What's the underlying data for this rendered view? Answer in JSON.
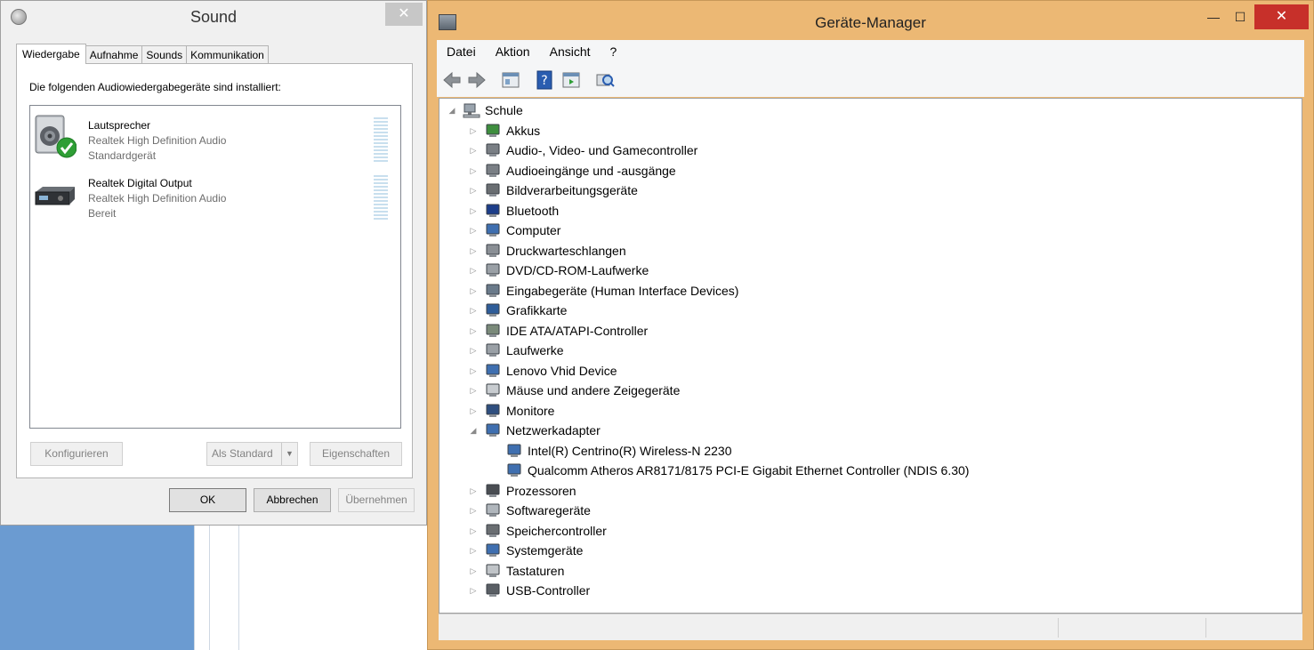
{
  "sound": {
    "title": "Sound",
    "close_glyph": "✕",
    "tabs": [
      "Wiedergabe",
      "Aufnahme",
      "Sounds",
      "Kommunikation"
    ],
    "heading": "Die folgenden Audiowiedergabegeräte sind installiert:",
    "devices": [
      {
        "name": "Lautsprecher",
        "driver": "Realtek High Definition Audio",
        "status": "Standardgerät",
        "icon": "speaker-icon"
      },
      {
        "name": "Realtek Digital Output",
        "driver": "Realtek High Definition Audio",
        "status": "Bereit",
        "icon": "digital-output-icon"
      }
    ],
    "buttons": {
      "configure": "Konfigurieren",
      "set_default": "Als Standard",
      "properties": "Eigenschaften",
      "ok": "OK",
      "cancel": "Abbrechen",
      "apply": "Übernehmen"
    }
  },
  "devmgr": {
    "title": "Geräte-Manager",
    "window_buttons": {
      "minimize": "—",
      "maximize": "☐",
      "close": "✕"
    },
    "menu": [
      "Datei",
      "Aktion",
      "Ansicht",
      "?"
    ],
    "root": "Schule",
    "categories": [
      {
        "label": "Akkus",
        "icon": "battery-icon"
      },
      {
        "label": "Audio-, Video- und Gamecontroller",
        "icon": "audio-icon"
      },
      {
        "label": "Audioeingänge und -ausgänge",
        "icon": "audio-io-icon"
      },
      {
        "label": "Bildverarbeitungsgeräte",
        "icon": "camera-icon"
      },
      {
        "label": "Bluetooth",
        "icon": "bluetooth-icon"
      },
      {
        "label": "Computer",
        "icon": "computer-icon"
      },
      {
        "label": "Druckwarteschlangen",
        "icon": "printer-icon"
      },
      {
        "label": "DVD/CD-ROM-Laufwerke",
        "icon": "dvd-icon"
      },
      {
        "label": "Eingabegeräte (Human Interface Devices)",
        "icon": "hid-icon"
      },
      {
        "label": "Grafikkarte",
        "icon": "display-adapter-icon"
      },
      {
        "label": "IDE ATA/ATAPI-Controller",
        "icon": "ide-icon"
      },
      {
        "label": "Laufwerke",
        "icon": "disk-drive-icon"
      },
      {
        "label": "Lenovo Vhid Device",
        "icon": "network-device-icon"
      },
      {
        "label": "Mäuse und andere Zeigegeräte",
        "icon": "mouse-icon"
      },
      {
        "label": "Monitore",
        "icon": "monitor-icon"
      },
      {
        "label": "Netzwerkadapter",
        "icon": "network-adapter-icon"
      }
    ],
    "network_children": [
      "Intel(R) Centrino(R) Wireless-N 2230",
      "Qualcomm Atheros AR8171/8175 PCI-E Gigabit Ethernet Controller (NDIS 6.30)"
    ],
    "categories_after": [
      {
        "label": "Prozessoren",
        "icon": "processor-icon"
      },
      {
        "label": "Softwaregeräte",
        "icon": "software-device-icon"
      },
      {
        "label": "Speichercontroller",
        "icon": "storage-controller-icon"
      },
      {
        "label": "Systemgeräte",
        "icon": "system-device-icon"
      },
      {
        "label": "Tastaturen",
        "icon": "keyboard-icon"
      },
      {
        "label": "USB-Controller",
        "icon": "usb-icon"
      }
    ],
    "glyphs": {
      "collapsed": "▷",
      "expanded": "◢"
    }
  }
}
